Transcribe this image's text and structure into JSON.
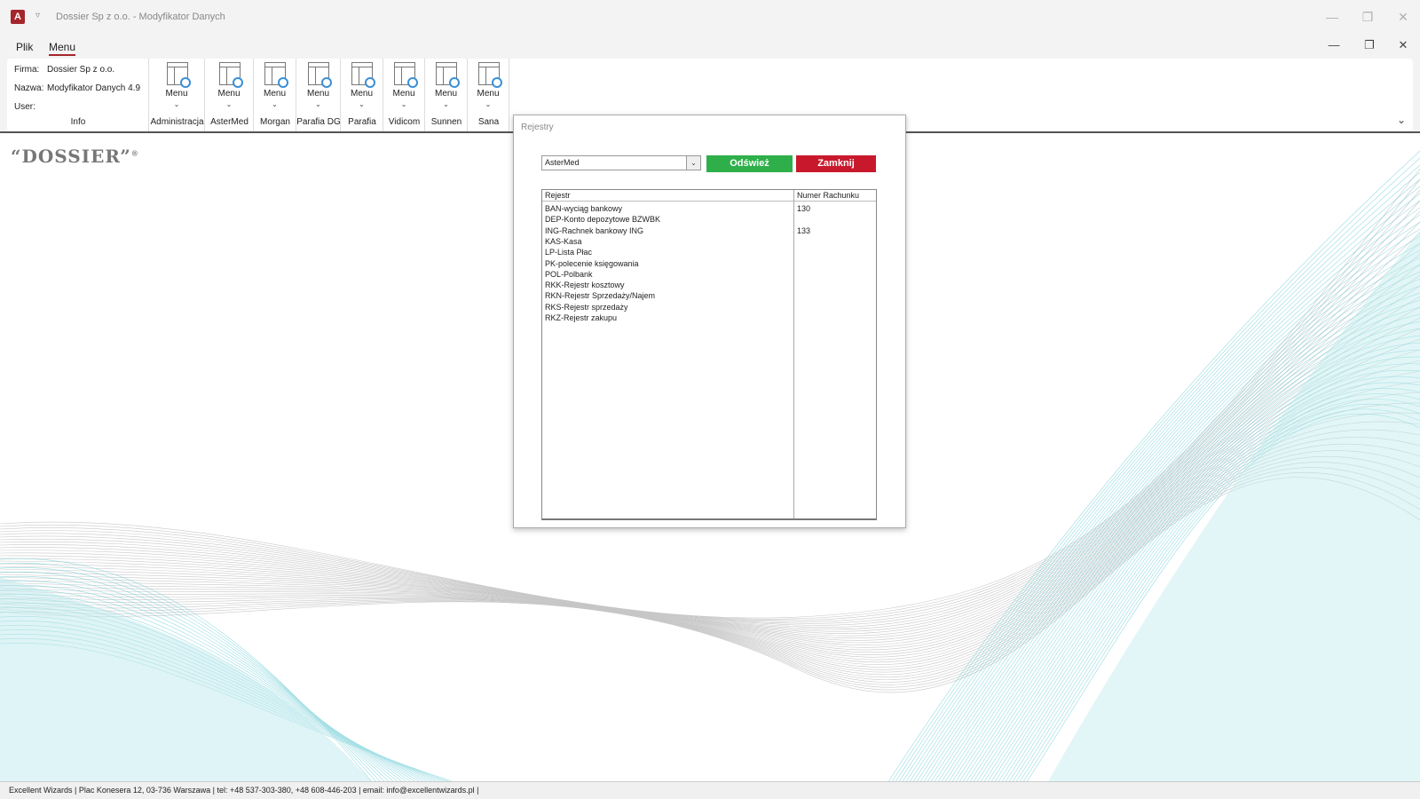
{
  "titlebar": {
    "app_icon": "A",
    "qat_icon": "▿",
    "title": "Dossier Sp z o.o. - Modyfikator Danych",
    "minimize": "—",
    "restore": "❐",
    "close": "✕"
  },
  "menu": {
    "tabs": [
      "Plik",
      "Menu"
    ],
    "active_tab": "Menu",
    "minimize": "—",
    "restore": "❐",
    "close": "✕"
  },
  "ribbon": {
    "info": {
      "firma_label": "Firma:",
      "firma_value": "Dossier Sp z o.o.",
      "nazwa_label": "Nazwa:",
      "nazwa_value": "Modyfikator Danych 4.9",
      "user_label": "User:",
      "user_value": "",
      "group_label": "Info"
    },
    "groups": [
      {
        "button": "Menu",
        "label": "Administracja"
      },
      {
        "button": "Menu",
        "label": "AsterMed"
      },
      {
        "button": "Menu",
        "label": "Morgan"
      },
      {
        "button": "Menu",
        "label": "Parafia DG"
      },
      {
        "button": "Menu",
        "label": "Parafia"
      },
      {
        "button": "Menu",
        "label": "Vidicom"
      },
      {
        "button": "Menu",
        "label": "Sunnen"
      },
      {
        "button": "Menu",
        "label": "Sana"
      }
    ],
    "collapse_icon": "⌄"
  },
  "logo": {
    "text": "“DOSSIER”",
    "mark": "®"
  },
  "dialog": {
    "title": "Rejestry",
    "combo_value": "AsterMed",
    "combo_arrow": "⌄",
    "refresh_label": "Odśwież",
    "close_label": "Zamknij",
    "columns": [
      "Rejestr",
      "Numer Rachunku"
    ],
    "rows": [
      {
        "rejestr": "BAN-wyciąg bankowy",
        "numer": "130"
      },
      {
        "rejestr": "DEP-Konto depozytowe BZWBK",
        "numer": ""
      },
      {
        "rejestr": "ING-Rachnek bankowy ING",
        "numer": "133"
      },
      {
        "rejestr": "KAS-Kasa",
        "numer": ""
      },
      {
        "rejestr": "LP-Lista Płac",
        "numer": ""
      },
      {
        "rejestr": "PK-polecenie księgowania",
        "numer": ""
      },
      {
        "rejestr": "POL-Polbank",
        "numer": ""
      },
      {
        "rejestr": "RKK-Rejestr kosztowy",
        "numer": ""
      },
      {
        "rejestr": "RKN-Rejestr Sprzedaży/Najem",
        "numer": ""
      },
      {
        "rejestr": "RKS-Rejestr sprzedaży",
        "numer": ""
      },
      {
        "rejestr": "RKZ-Rejestr zakupu",
        "numer": ""
      }
    ]
  },
  "statusbar": {
    "text": "Excellent Wizards | Plac Konesera 12, 03-736 Warszawa | tel: +48 537-303-380, +48 608-446-203 | email: info@excellentwizards.pl |"
  },
  "colors": {
    "accent": "#a4262c",
    "refresh_button": "#2eaf4a",
    "close_button": "#c8192c",
    "wave_teal": "#5cc6d0",
    "wave_grey": "#9a9a9a"
  }
}
